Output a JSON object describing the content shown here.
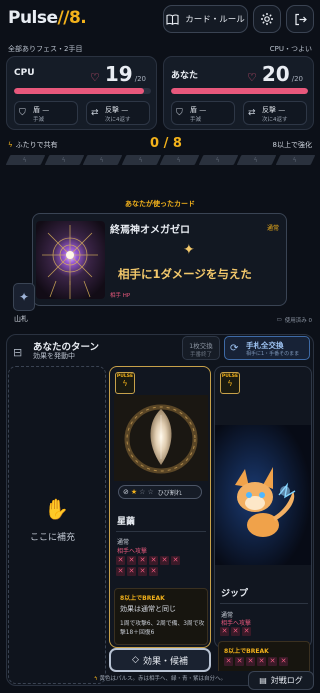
{
  "header": {
    "logo_main": "Pulse",
    "logo_accent": "//8.",
    "rules_label": "カード・ルール",
    "subtitle_left": "全部ありフェス・2手目",
    "subtitle_right": "CPU・つよい"
  },
  "cpu": {
    "name": "CPU",
    "hp": "19",
    "hp_max": "/20",
    "hp_fraction": 0.95,
    "stat1_title": "盾 —",
    "stat1_sub": "手減",
    "stat2_title": "反撃 —",
    "stat2_sub": "次に4返す"
  },
  "player": {
    "name": "あなた",
    "hp": "20",
    "hp_max": "/20",
    "hp_fraction": 1.0,
    "stat1_title": "盾 —",
    "stat1_sub": "手減",
    "stat2_title": "反撃 —",
    "stat2_sub": "次に4返す"
  },
  "shared": {
    "label": "ふたりで共有",
    "counter": "0 / 8",
    "boost_label": "8以上で強化",
    "slots_filled": 0,
    "slots_total": 8
  },
  "used_card": {
    "section_title": "あなたが使ったカード",
    "name": "終焉神オメガゼロ",
    "rarity": "通常",
    "effect": "相手に1ダメージを与えた",
    "target": "相手 HP"
  },
  "deck": {
    "label": "山札",
    "used_count": "使用済み 0"
  },
  "turn": {
    "title": "あなたのターン",
    "subtitle": "効果を発動中",
    "swap_one_label": "1枚交換",
    "swap_one_sub": "手番終了",
    "swap_all_label": "手札全交換",
    "swap_all_sub": "相手に1・手番そのまま",
    "empty_slot_label": "ここに補充"
  },
  "hand": [
    {
      "badge": "PULSE",
      "name": "星繭",
      "stars_on": 1,
      "stars_total": 3,
      "stars_label": "ひび割れ",
      "rarity": "通常",
      "target": "相手へ攻撃",
      "x_count": 10,
      "break_title": "8以上でBREAK",
      "break_main": "効果は通常と同じ",
      "break_note": "1周で攻撃6、2周で備、3周で攻撃18＋回復6"
    },
    {
      "badge": "PULSE",
      "name": "ジップ",
      "rarity": "通常",
      "target": "相手へ攻撃",
      "x_count": 3,
      "break_title": "8以上でBREAK",
      "break_x_count": 6
    }
  ],
  "actions": {
    "effect_button": "効果・候補",
    "log_button": "対戦ログ"
  },
  "footer": {
    "note": "黄色はパルス。赤は相手へ、緑・青・紫は自分へ。"
  },
  "colors": {
    "accent": "#f3b21b",
    "hp": "#e8587c",
    "bg": "#0c1018"
  }
}
